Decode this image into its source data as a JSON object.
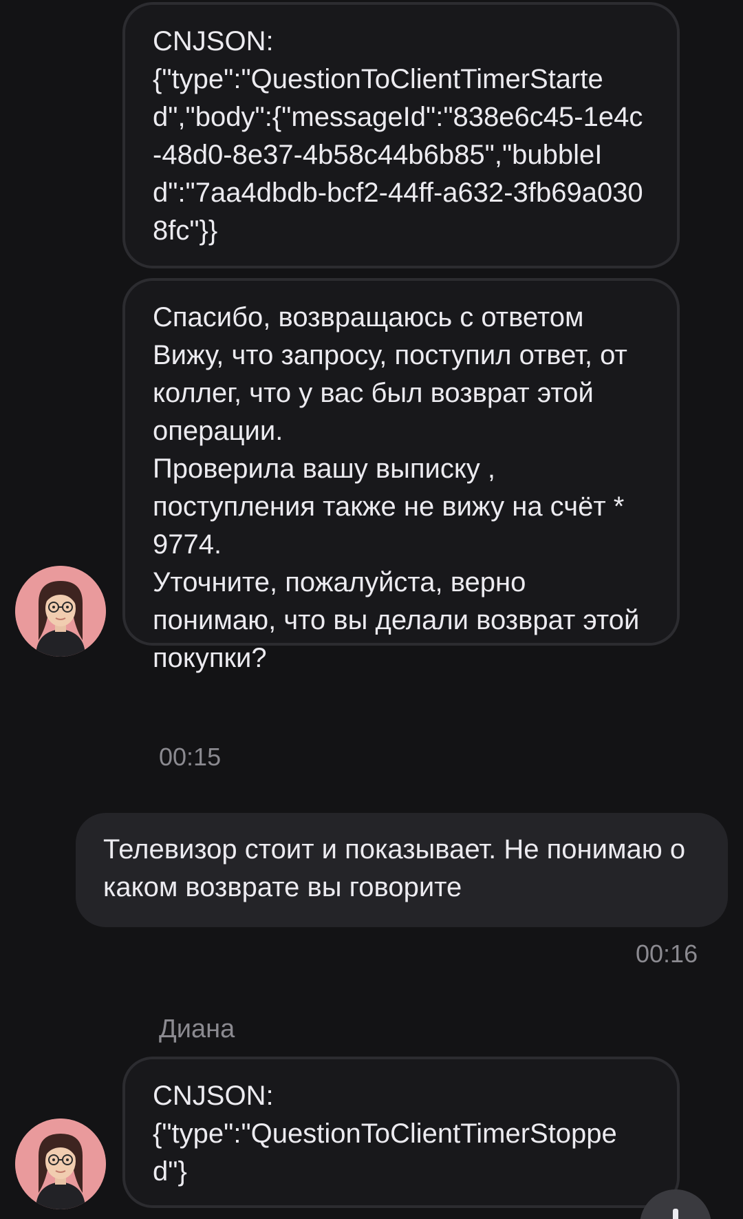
{
  "messages": [
    {
      "text": "CNJSON:\n{\"type\":\"QuestionToClientTimerStarted\",\"body\":{\"messageId\":\"838e6c45-1e4c-48d0-8e37-4b58c44b6b85\",\"bubbleId\":\"7aa4dbdb-bcf2-44ff-a632-3fb69a0308fc\"}}"
    },
    {
      "text": "Спасибо, возвращаюсь с ответом\nВижу, что запросу, поступил ответ, от коллег, что у вас был возврат этой операции.\nПроверила вашу выписку , поступления также не вижу на счёт * 9774.\nУточните, пожалуйста, верно понимаю, что вы делали возврат этой покупки?",
      "time": "00:15"
    },
    {
      "text": "Телевизор стоит и показывает. Не понимаю о каком возврате вы говорите",
      "time": "00:16"
    },
    {
      "sender": "Диана",
      "text": "CNJSON:\n{\"type\":\"QuestionToClientTimerStopped\"}"
    }
  ],
  "icons": {
    "avatar": "operator-avatar",
    "fab": "scroll-down-button"
  },
  "colors": {
    "background": "#131315",
    "incoming_bubble": "#18181b",
    "incoming_border": "#2c2c30",
    "outgoing_bubble": "#242428",
    "text": "#ecebf0",
    "meta_text": "#8b8a90",
    "avatar_bg": "#e99a9c"
  }
}
